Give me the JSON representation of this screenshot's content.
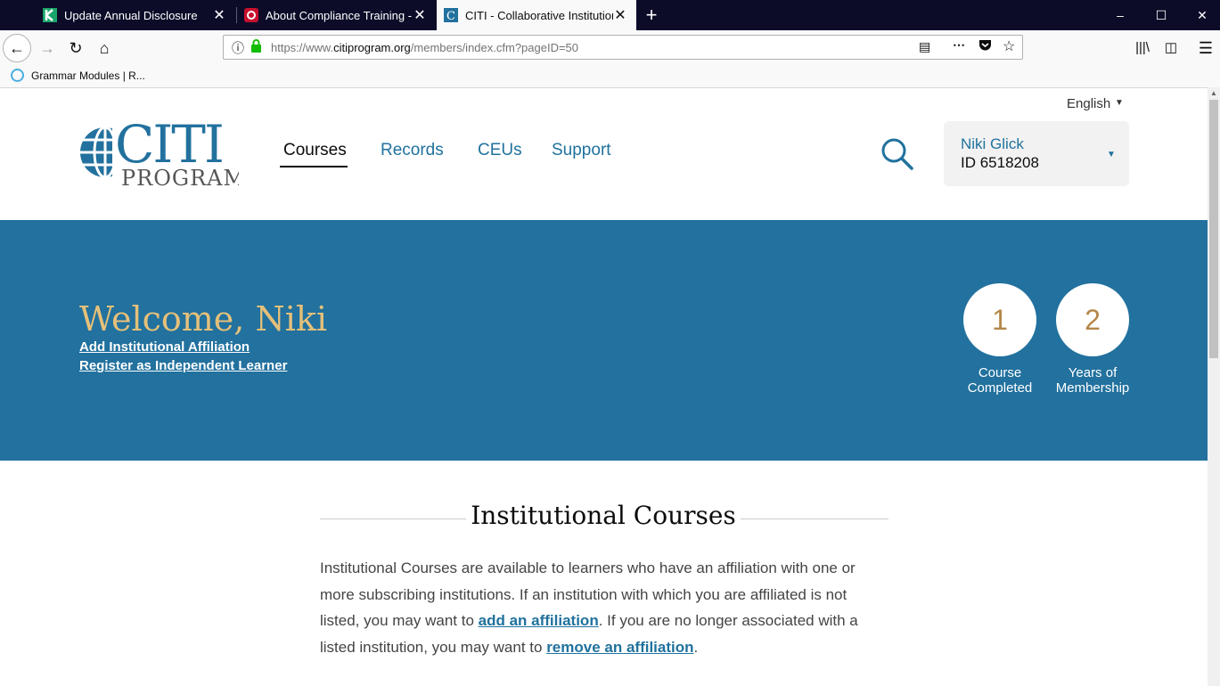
{
  "browser": {
    "tabs": [
      {
        "title": "Update Annual Disclosure",
        "favicon": "k-logo-icon",
        "active": false
      },
      {
        "title": "About Compliance Training - Ir",
        "favicon": "red-e-icon",
        "active": false
      },
      {
        "title": "CITI - Collaborative Institutiona",
        "favicon": "citi-c-icon",
        "active": true
      }
    ],
    "url": {
      "prefix": "https://www.",
      "domain": "citiprogram.org",
      "path": "/members/index.cfm?pageID=50"
    },
    "bookmarks": [
      {
        "label": "Grammar Modules | R..."
      }
    ]
  },
  "site": {
    "logo": {
      "line1": "CITI",
      "line2": "PROGRAM"
    },
    "nav": [
      {
        "label": "Courses",
        "active": true
      },
      {
        "label": "Records"
      },
      {
        "label": "CEUs"
      },
      {
        "label": "Support"
      }
    ],
    "language": "English",
    "user": {
      "name": "Niki Glick",
      "id": "ID 6518208"
    }
  },
  "banner": {
    "welcome": "Welcome, Niki",
    "links": {
      "affiliation": "Add Institutional Affiliation",
      "independent": "Register as Independent Learner"
    },
    "stats": [
      {
        "value": "1",
        "label_line1": "Course",
        "label_line2": "Completed"
      },
      {
        "value": "2",
        "label_line1": "Years of",
        "label_line2": "Membership"
      }
    ]
  },
  "section": {
    "title": "Institutional Courses",
    "text1": "Institutional Courses are available to learners who have an affiliation with one or more subscribing institutions. If an institution with which you are affiliated is not listed, you may want to ",
    "link1": "add an affiliation",
    "text2": ". If you are no longer associated with a listed institution, you may want to ",
    "link2": "remove an affiliation",
    "text3": "."
  },
  "colors": {
    "brand_blue": "#22719e",
    "link_blue": "#20729e",
    "gold": "#e5c07a",
    "stat_gold": "#b5874a"
  }
}
